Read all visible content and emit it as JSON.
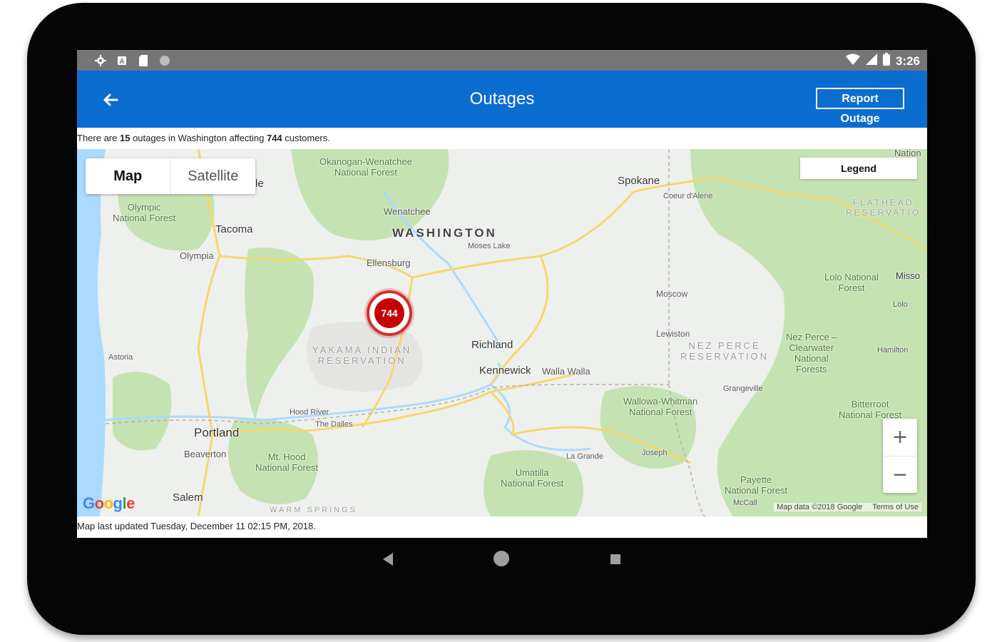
{
  "status_bar": {
    "time": "3:26",
    "left_icons": [
      "gear-icon",
      "notification-icon",
      "sd-card-icon",
      "circle-icon"
    ],
    "right_icons": [
      "wifi-icon",
      "signal-icon",
      "battery-icon"
    ]
  },
  "app_bar": {
    "title": "Outages",
    "report_button": "Report Outage",
    "back_icon": "arrow-left-icon",
    "color": "#0a6dd0"
  },
  "summary": {
    "prefix": "There are ",
    "outage_count": "15",
    "mid1": " outages in Washington affecting ",
    "customer_count": "744",
    "suffix": " customers."
  },
  "map": {
    "type_control": {
      "map_label": "Map",
      "satellite_label": "Satellite"
    },
    "legend_label": "Legend",
    "zoom_in": "+",
    "zoom_out": "−",
    "marker": {
      "value": "744",
      "color": "#c40000"
    },
    "google_logo": "Google",
    "attribution": {
      "map_data": "Map data ©2018 Google",
      "terms": "Terms of Use"
    },
    "labels": {
      "washington": "WASHINGTON",
      "spokane": "Spokane",
      "tacoma": "Tacoma",
      "olympia": "Olympia",
      "wenatchee": "Wenatchee",
      "moses_lake": "Moses Lake",
      "ellensburg": "Ellensburg",
      "richland": "Richland",
      "kennewick": "Kennewick",
      "walla_walla": "Walla Walla",
      "portland": "Portland",
      "beaverton": "Beaverton",
      "salem": "Salem",
      "hood_river": "Hood River",
      "the_dalles": "The Dalles",
      "moscow": "Moscow",
      "lewiston": "Lewiston",
      "coeur_dalene": "Coeur d'Alene",
      "grangeville": "Grangeville",
      "la_grande": "La Grande",
      "joseph": "Joseph",
      "astoria": "Astoria",
      "hamilton": "Hamilton",
      "lolo": "Lolo",
      "missoula": "Misso",
      "nation": "Nation",
      "mccall": "McCall",
      "seattle_fragment": "le",
      "okanogan": "Okanogan-Wenatchee\nNational Forest",
      "olympic": "Olympic\nNational Forest",
      "yakama": "YAKAMA INDIAN\nRESERVATION",
      "nez_perce_res": "NEZ PERCE\nRESERVATION",
      "flathead": "FLATHEAD\nRESERVATIO",
      "lolo_forest": "Lolo National\nForest",
      "nez_perce_forest": "Nez Perce –\nClearwater\nNational\nForests",
      "wallowa": "Wallowa-Whitman\nNational Forest",
      "bitterroot": "Bitterroot\nNational Forest",
      "mt_hood": "Mt. Hood\nNational Forest",
      "umatilla": "Umatilla\nNational Forest",
      "payette": "Payette\nNational Forest",
      "warm_springs": "WARM SPRINGS"
    }
  },
  "updated": "Map last updated Tuesday, December 11 02:15 PM, 2018."
}
